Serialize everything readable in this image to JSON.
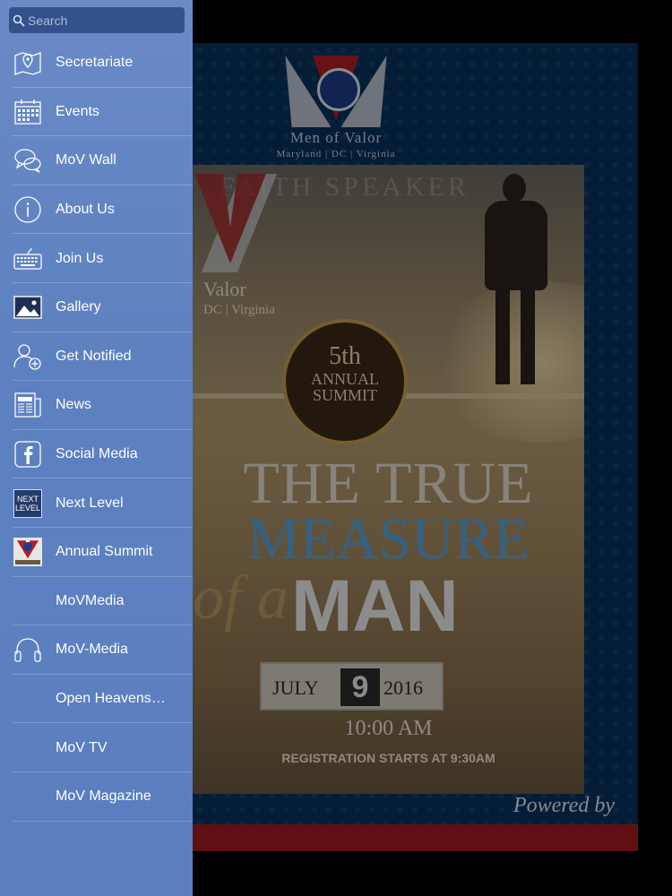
{
  "search": {
    "placeholder": "Search"
  },
  "sidebar": {
    "items": [
      {
        "label": "Secretariate",
        "icon": "map-pin-icon"
      },
      {
        "label": "Events",
        "icon": "calendar-icon"
      },
      {
        "label": "MoV Wall",
        "icon": "chat-bubbles-icon"
      },
      {
        "label": "About Us",
        "icon": "info-icon"
      },
      {
        "label": "Join Us",
        "icon": "keyboard-icon"
      },
      {
        "label": "Gallery",
        "icon": "picture-icon"
      },
      {
        "label": "Get Notified",
        "icon": "add-user-icon"
      },
      {
        "label": "News",
        "icon": "newspaper-icon"
      },
      {
        "label": "Social Media",
        "icon": "facebook-icon"
      },
      {
        "label": "Next Level",
        "icon": "next-level-icon"
      },
      {
        "label": "Annual Summit",
        "icon": "annual-summit-icon"
      },
      {
        "label": "MoVMedia",
        "icon": ""
      },
      {
        "label": "MoV-Media",
        "icon": "headphones-icon"
      },
      {
        "label": "Open Heavens…",
        "icon": ""
      },
      {
        "label": "MoV TV",
        "icon": ""
      },
      {
        "label": "MoV Magazine",
        "icon": ""
      }
    ]
  },
  "next_level_icon": {
    "line1": "NEXT",
    "line2": "LEVEL"
  },
  "poster": {
    "brand": "Men of Valor",
    "brand_sub": "Maryland | DC | Virginia",
    "faint_top": "FAITH SPEAKER",
    "ghost_brand": "Valor",
    "ghost_sub": "DC | Virginia",
    "badge_number": "5th",
    "badge_line1": "ANNUAL",
    "badge_line2": "SUMMIT",
    "headline1": "THE TRUE",
    "headline2": "MEASURE",
    "headline3_of": "of a",
    "headline3": "MAN",
    "date_month": "JULY",
    "date_day": "9",
    "date_year": "2016",
    "time": "10:00 AM",
    "registration": "REGISTRATION STARTS AT 9:30AM",
    "powered_by": "Powered by"
  },
  "colors": {
    "sidebar": "#5d81c0",
    "search_bg": "#33528c",
    "poster_bg": "#08325f",
    "brand_red": "#b42025"
  }
}
